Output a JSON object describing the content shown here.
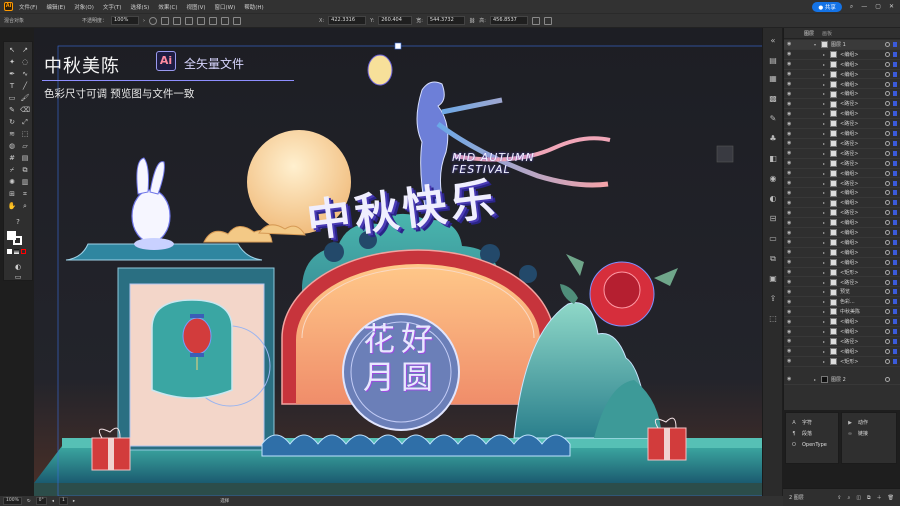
{
  "menubar": {
    "logo": "Ai",
    "items": [
      "文件(F)",
      "编辑(E)",
      "对象(O)",
      "文字(T)",
      "选择(S)",
      "效果(C)",
      "视图(V)",
      "窗口(W)",
      "帮助(H)"
    ],
    "share_label": "共享"
  },
  "ctrlbar": {
    "object_type": "混合对象",
    "opacity_label": "不透明度：",
    "opacity_value": "100%",
    "x_label": "X:",
    "x_value": "422.3316",
    "y_label": "Y:",
    "y_value": "260.404",
    "w_label": "宽:",
    "w_value": "544.3732",
    "h_label": "高:",
    "h_value": "456.8537"
  },
  "canvas": {
    "title": "中秋美陈",
    "badge": "Ai",
    "vector_label": "全矢量文件",
    "subtitle": "色彩尺寸可调  预览图与文件一致",
    "festival_line1": "MID AUTUMN",
    "festival_line2": "FESTIVAL",
    "hero": "中秋快乐",
    "round_top": "花好",
    "round_bottom": "月圆"
  },
  "layers_panel": {
    "tabs": [
      "图层",
      "画板"
    ],
    "top_layer": "图层 1",
    "rows": [
      "<编组>",
      "<编组>",
      "<编组>",
      "<编组>",
      "<编组>",
      "<路径>",
      "<编组>",
      "<路径>",
      "<编组>",
      "<路径>",
      "<路径>",
      "<路径>",
      "<编组>",
      "<路径>",
      "<编组>",
      "<编组>",
      "<路径>",
      "<编组>",
      "<编组>",
      "<编组>",
      "<编组>",
      "<编组>",
      "<矩形>",
      "<路径>",
      "预览",
      "色彩...",
      "中秋美陈",
      "<编组>",
      "<编组>",
      "<路径>",
      "<编组>",
      "<矩形>"
    ],
    "bottom_layer": "图层 2",
    "footer_label": "2 图层"
  },
  "char_panel": {
    "items": [
      "字符",
      "段落",
      "OpenType"
    ]
  },
  "action_panel": {
    "items": [
      "动作",
      "链接"
    ]
  },
  "statusbar": {
    "zoom": "100%",
    "angle": "0°",
    "artboard": "1",
    "tool": "选择"
  },
  "colors": {
    "accent": "#1473e6",
    "layer_select": "#3b5bdb",
    "scene_teal": "#3aa6a3",
    "scene_red": "#d23c3c",
    "moon": "#f6cf95",
    "text_glow": "#5a4bd6"
  }
}
